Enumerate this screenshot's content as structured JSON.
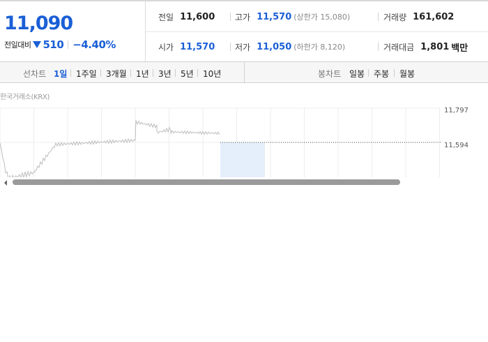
{
  "quote": {
    "price": "11,090",
    "change_label": "전일대비",
    "change": "510",
    "change_pct": "−4.40%"
  },
  "summary": {
    "prev_close_label": "전일",
    "prev_close": "11,600",
    "high_label": "고가",
    "high": "11,570",
    "upper_limit": "(상한가 15,080)",
    "volume_label": "거래량",
    "volume": "161,602",
    "open_label": "시가",
    "open": "11,570",
    "low_label": "저가",
    "low": "11,050",
    "lower_limit": "(하한가 8,120)",
    "amount_label": "거래대금",
    "amount": "1,801",
    "amount_unit": "백만"
  },
  "line_tabs": {
    "label": "선차트",
    "items": [
      "1일",
      "1주일",
      "3개월",
      "1년",
      "3년",
      "5년",
      "10년"
    ],
    "active": "1일"
  },
  "candle_tabs": {
    "label": "봉차트",
    "items": [
      "일봉",
      "주봉",
      "월봉"
    ]
  },
  "chart": {
    "source": "한국거래소(KRX)",
    "y_ticks": [
      "11,797",
      "11,594"
    ],
    "prev_close_value": 11594,
    "colors": {
      "line": "#bdbdbd",
      "grid": "#ececec",
      "selection": "#e5eefb",
      "scrollbar": "#9a9a9a"
    }
  },
  "colors": {
    "accent_blue": "#1a5fd6",
    "text": "#222222"
  }
}
